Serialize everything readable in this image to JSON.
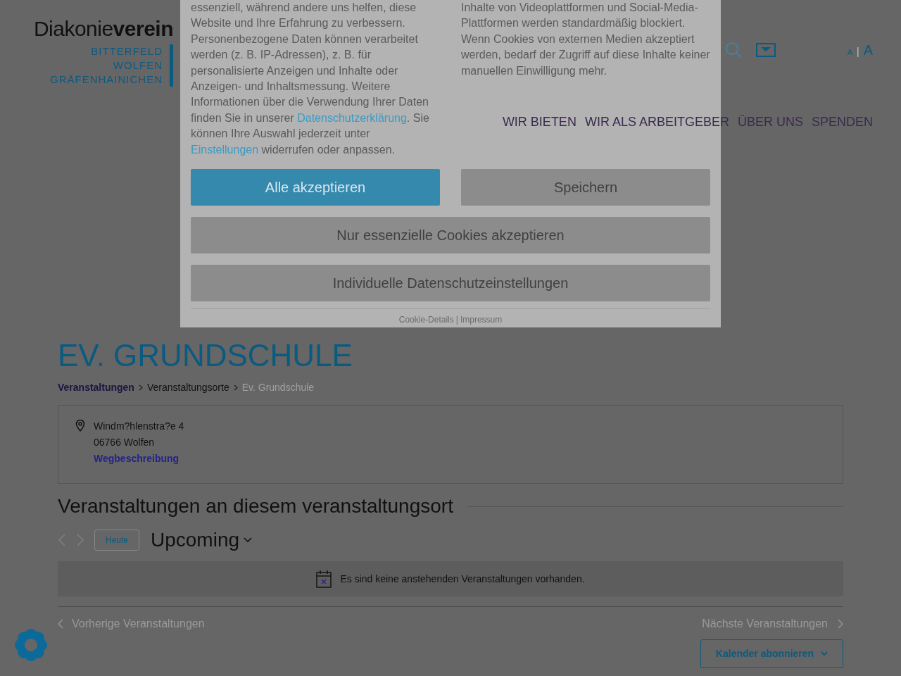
{
  "header": {
    "logo": {
      "word_light": "Diakonie",
      "word_bold": "verein",
      "places": [
        "BITTERFELD",
        "WOLFEN",
        "GRÄFENHAINICHEN"
      ]
    },
    "font_size_small": "A",
    "font_size_separator": "|",
    "font_size_large": "A"
  },
  "nav": [
    {
      "label": "WIR BIETEN"
    },
    {
      "label": "WIR ALS ARBEITGEBER"
    },
    {
      "label": "ÜBER UNS"
    },
    {
      "label": "SPENDEN"
    }
  ],
  "page_title": "EV. GRUNDSCHULE",
  "breadcrumb": [
    {
      "label": "Veranstaltungen",
      "kind": "link"
    },
    {
      "label": "Veranstaltungsorte",
      "kind": "link"
    },
    {
      "label": "Ev. Grundschule",
      "kind": "current"
    }
  ],
  "venue": {
    "street": "Windm?hlenstra?e 4",
    "city": "06766 Wolfen",
    "directions": "Wegbeschreibung"
  },
  "events_heading": "Veranstaltungen an diesem veranstaltungsort",
  "events_toolbar": {
    "today": "Heute",
    "view": "Upcoming"
  },
  "notice": "Es sind keine anstehenden Veranstaltungen vorhanden.",
  "pager": {
    "previous": "Vorherige Veranstaltungen",
    "next": "Nächste Veranstaltungen"
  },
  "subscribe": "Kalender abonnieren",
  "cookie_dialog": {
    "text_left": [
      {
        "text": "essenziell, während andere uns helfen, diese Website und Ihre Erfahrung zu verbessern. Personenbezogene Daten können verarbeitet werden (z. B. IP-Adressen), z. B. für personalisierte Anzeigen und Inhalte oder Anzeigen- und Inhaltsmessung. Weitere Informationen über die Verwendung Ihrer Daten finden Sie in unserer ",
        "kind": "text"
      },
      {
        "text": "Datenschutzerklärung",
        "kind": "link"
      },
      {
        "text": ". Sie können Ihre Auswahl jederzeit unter ",
        "kind": "text"
      },
      {
        "text": "Einstellungen",
        "kind": "link"
      },
      {
        "text": " widerrufen oder anpassen.",
        "kind": "text"
      }
    ],
    "text_right": "Inhalte von Videoplattformen und Social-Media-Plattformen werden standardmäßig blockiert. Wenn Cookies von externen Medien akzeptiert werden, bedarf der Zugriff auf diese Inhalte keiner manuellen Einwilligung mehr.",
    "buttons": [
      {
        "label": "Alle akzeptieren",
        "kind": "primary"
      },
      {
        "label": "Speichern",
        "kind": "secondary"
      },
      {
        "label": "Nur essenzielle Cookies akzeptieren",
        "kind": "wide"
      },
      {
        "label": "Individuelle Datenschutzeinstellungen",
        "kind": "wide"
      }
    ],
    "footer_links": [
      "Cookie-Details",
      "Impressum"
    ],
    "footer_separator": "|"
  }
}
